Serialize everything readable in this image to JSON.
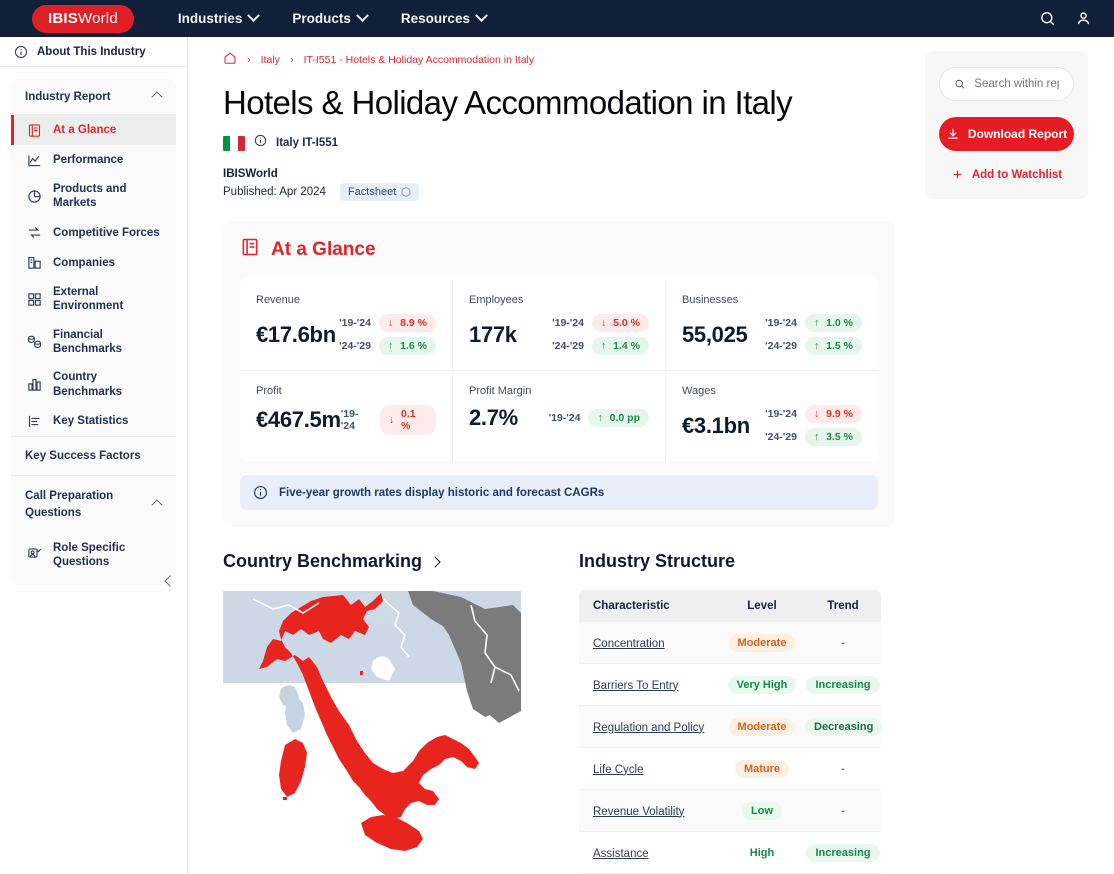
{
  "topnav": {
    "brand_bold": "IBIS",
    "brand_light": "World",
    "items": [
      {
        "label": "Industries"
      },
      {
        "label": "Products"
      },
      {
        "label": "Resources"
      }
    ],
    "search_icon": "search-icon",
    "account_icon": "user-icon"
  },
  "sidebar": {
    "about": "About This Industry",
    "group_title": "Industry Report",
    "items": [
      {
        "label": "At a Glance",
        "icon": "report-icon",
        "active": true
      },
      {
        "label": "Performance",
        "icon": "line-chart-icon",
        "active": false
      },
      {
        "label": "Products and Markets",
        "icon": "pie-chart-icon",
        "active": false
      },
      {
        "label": "Competitive Forces",
        "icon": "arrows-icon",
        "active": false
      },
      {
        "label": "Companies",
        "icon": "building-icon",
        "active": false
      },
      {
        "label": "External Environment",
        "icon": "grid-icon",
        "active": false
      },
      {
        "label": "Financial Benchmarks",
        "icon": "coins-icon",
        "active": false
      },
      {
        "label": "Country Benchmarks",
        "icon": "bar-chart-icon",
        "active": false
      },
      {
        "label": "Key Statistics",
        "icon": "stats-icon",
        "active": false
      }
    ],
    "key_success": "Key Success Factors",
    "call_prep": "Call Preparation Questions",
    "role_specific": "Role Specific Questions"
  },
  "breadcrumb": {
    "home": "home-icon",
    "country": "Italy",
    "current": "IT-I551 - Hotels & Holiday Accommodation in Italy"
  },
  "header": {
    "title": "Hotels & Holiday Accommodation in Italy",
    "country_code": "Italy IT-I551",
    "publisher": "IBISWorld",
    "published": "Published: Apr 2024",
    "factsheet": "Factsheet"
  },
  "glance": {
    "title": "At a Glance",
    "note": "Five-year growth rates display historic and forecast CAGRs",
    "metrics": [
      {
        "label": "Revenue",
        "value": "€17.6bn",
        "chips": [
          {
            "period": "'19-'24",
            "delta": "8.9 %",
            "dir": "down"
          },
          {
            "period": "'24-'29",
            "delta": "1.6 %",
            "dir": "up"
          }
        ]
      },
      {
        "label": "Employees",
        "value": "177k",
        "chips": [
          {
            "period": "'19-'24",
            "delta": "5.0 %",
            "dir": "down"
          },
          {
            "period": "'24-'29",
            "delta": "1.4 %",
            "dir": "up"
          }
        ]
      },
      {
        "label": "Businesses",
        "value": "55,025",
        "chips": [
          {
            "period": "'19-'24",
            "delta": "1.0 %",
            "dir": "up"
          },
          {
            "period": "'24-'29",
            "delta": "1.5 %",
            "dir": "up"
          }
        ]
      },
      {
        "label": "Profit",
        "value": "€467.5m",
        "chips": [
          {
            "period": "'19-'24",
            "delta": "0.1 %",
            "dir": "down"
          }
        ]
      },
      {
        "label": "Profit Margin",
        "value": "2.7%",
        "chips": [
          {
            "period": "'19-'24",
            "delta": "0.0 pp",
            "dir": "up"
          }
        ]
      },
      {
        "label": "Wages",
        "value": "€3.1bn",
        "chips": [
          {
            "period": "'19-'24",
            "delta": "9.9 %",
            "dir": "down"
          },
          {
            "period": "'24-'29",
            "delta": "3.5 %",
            "dir": "up"
          }
        ]
      }
    ]
  },
  "country_benchmarking": {
    "title": "Country Benchmarking",
    "map_alt": "italy-map"
  },
  "industry_structure": {
    "title": "Industry Structure",
    "columns": [
      "Characteristic",
      "Level",
      "Trend"
    ],
    "rows": [
      {
        "characteristic": "Concentration",
        "level": "Moderate",
        "level_class": "moderate",
        "trend": "-",
        "trend_class": "none"
      },
      {
        "characteristic": "Barriers To Entry",
        "level": "Very High",
        "level_class": "vhigh",
        "trend": "Increasing",
        "trend_class": "inc"
      },
      {
        "characteristic": "Regulation and Policy",
        "level": "Moderate",
        "level_class": "moderate",
        "trend": "Decreasing",
        "trend_class": "dec"
      },
      {
        "characteristic": "Life Cycle",
        "level": "Mature",
        "level_class": "mature",
        "trend": "-",
        "trend_class": "none"
      },
      {
        "characteristic": "Revenue Volatility",
        "level": "Low",
        "level_class": "low",
        "trend": "-",
        "trend_class": "none"
      },
      {
        "characteristic": "Assistance",
        "level": "High",
        "level_class": "high",
        "trend": "Increasing",
        "trend_class": "inc"
      }
    ]
  },
  "rail": {
    "search_placeholder": "Search within report",
    "download_label": "Download Report",
    "watchlist_label": "Add to Watchlist"
  },
  "colors": {
    "brand_red": "#e51c24",
    "nav_navy": "#111f38",
    "up_green": "#1d8a4d",
    "down_red": "#d93025",
    "map_red": "#e8241f"
  }
}
